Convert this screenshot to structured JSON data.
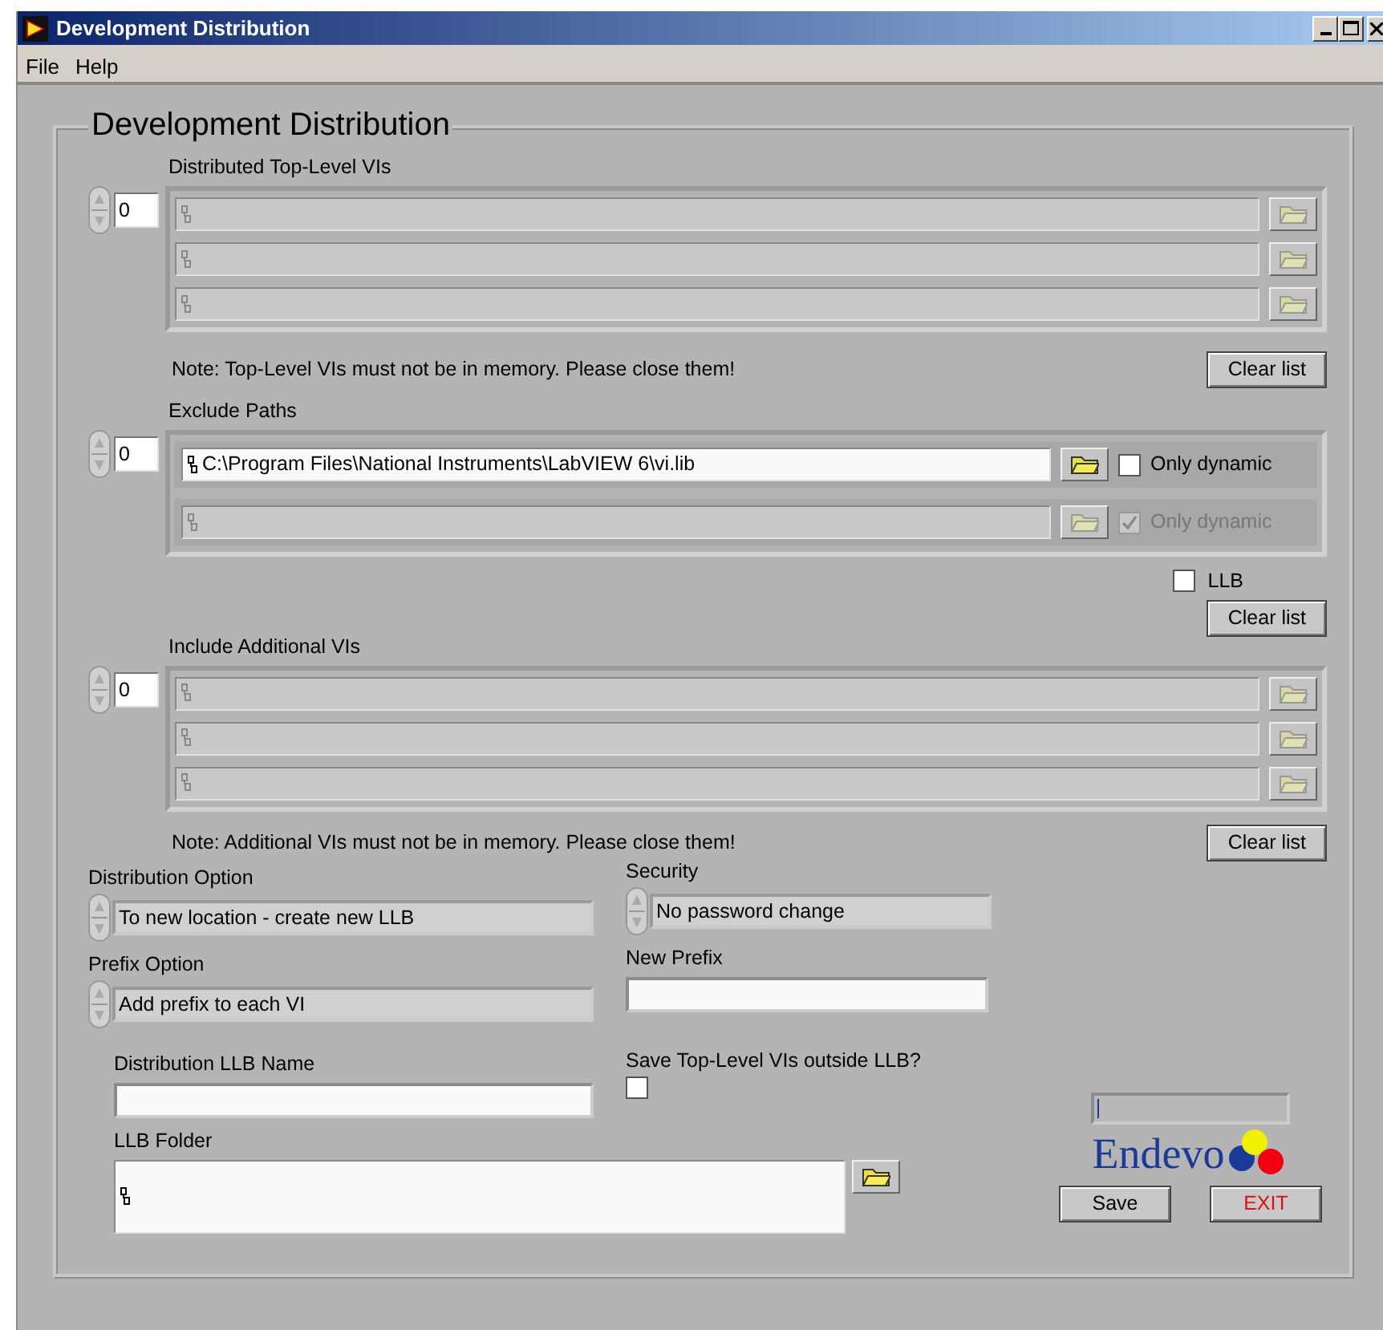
{
  "window": {
    "title": "Development Distribution"
  },
  "menu": [
    "File",
    "Help"
  ],
  "panel_title": "Development Distribution",
  "sections": [
    {
      "label": "Distributed Top-Level VIs",
      "index": "0",
      "rows": [
        {
          "kind": "path",
          "disabled": true
        },
        {
          "kind": "path",
          "disabled": true
        },
        {
          "kind": "path",
          "disabled": true
        }
      ],
      "note": "Note: Top-Level VIs must not be in memory. Please close them!",
      "clear_button": "Clear list"
    },
    {
      "label": "Exclude Paths",
      "index": "0",
      "rows": [
        {
          "kind": "path_option",
          "value": "C:\\Program Files\\National Instruments\\LabVIEW 6\\vi.lib",
          "disabled": false,
          "option": {
            "label": "Only dynamic",
            "checked": false
          }
        },
        {
          "kind": "path_option",
          "disabled": true,
          "option": {
            "label": "Only dynamic",
            "checked": true
          }
        }
      ],
      "extra_checkbox": {
        "label": "LLB",
        "checked": false
      },
      "clear_button": "Clear list"
    },
    {
      "label": "Include Additional VIs",
      "index": "0",
      "rows": [
        {
          "kind": "path",
          "disabled": true
        },
        {
          "kind": "path",
          "disabled": true
        },
        {
          "kind": "path",
          "disabled": true
        }
      ],
      "note": "Note: Additional VIs must not be in memory. Please close them!",
      "clear_button": "Clear list"
    }
  ],
  "distribution_option": {
    "label": "Distribution Option",
    "value": "To new location - create new LLB"
  },
  "security": {
    "label": "Security",
    "value": "No password change"
  },
  "prefix_option": {
    "label": "Prefix Option",
    "value": "Add prefix to each VI"
  },
  "new_prefix": {
    "label": "New Prefix"
  },
  "llb_name": {
    "label": "Distribution LLB Name"
  },
  "save_outside": {
    "label": "Save Top-Level VIs outside LLB?",
    "checked": false
  },
  "llb_folder": {
    "label": "LLB Folder"
  },
  "progress": {
    "level": 0.01
  },
  "logo": {
    "text": "Endevo"
  },
  "buttons": [
    {
      "label": "Save",
      "kind": "normal"
    },
    {
      "label": "EXIT",
      "kind": "exit"
    }
  ]
}
